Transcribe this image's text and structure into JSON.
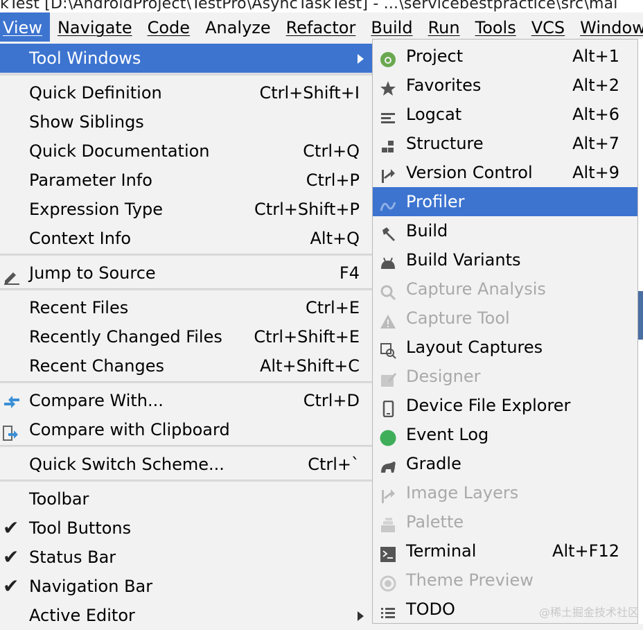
{
  "window": {
    "title": "kTest [D:\\AndroidProject\\TestPro\\AsyncTaskTest] - ...\\servicebestpractice\\src\\mai"
  },
  "menubar": {
    "items": [
      {
        "label": "View",
        "active": true
      },
      {
        "label": "Navigate"
      },
      {
        "label": "Code"
      },
      {
        "label": "Analyze"
      },
      {
        "label": "Refactor"
      },
      {
        "label": "Build"
      },
      {
        "label": "Run"
      },
      {
        "label": "Tools"
      },
      {
        "label": "VCS"
      },
      {
        "label": "Window"
      }
    ]
  },
  "view_menu": {
    "items": [
      {
        "label": "Tool Windows",
        "shortcut": "",
        "submenu": true,
        "highlighted": true
      },
      {
        "label": "Quick Definition",
        "shortcut": "Ctrl+Shift+I"
      },
      {
        "label": "Show Siblings",
        "shortcut": ""
      },
      {
        "label": "Quick Documentation",
        "shortcut": "Ctrl+Q"
      },
      {
        "label": "Parameter Info",
        "shortcut": "Ctrl+P"
      },
      {
        "label": "Expression Type",
        "shortcut": "Ctrl+Shift+P"
      },
      {
        "label": "Context Info",
        "shortcut": "Alt+Q"
      },
      {
        "label": "Jump to Source",
        "shortcut": "F4",
        "icon": "pencil-icon"
      },
      {
        "label": "Recent Files",
        "shortcut": "Ctrl+E"
      },
      {
        "label": "Recently Changed Files",
        "shortcut": "Ctrl+Shift+E"
      },
      {
        "label": "Recent Changes",
        "shortcut": "Alt+Shift+C"
      },
      {
        "label": "Compare With...",
        "shortcut": "Ctrl+D",
        "icon": "compare-arrows-icon"
      },
      {
        "label": "Compare with Clipboard",
        "shortcut": "",
        "icon": "compare-clipboard-icon"
      },
      {
        "label": "Quick Switch Scheme...",
        "shortcut": "Ctrl+`"
      },
      {
        "label": "Toolbar",
        "shortcut": ""
      },
      {
        "label": "Tool Buttons",
        "shortcut": "",
        "checked": true
      },
      {
        "label": "Status Bar",
        "shortcut": "",
        "checked": true
      },
      {
        "label": "Navigation Bar",
        "shortcut": "",
        "checked": true
      },
      {
        "label": "Active Editor",
        "shortcut": "",
        "submenu": true
      }
    ]
  },
  "tool_windows": {
    "items": [
      {
        "label": "Project",
        "shortcut": "Alt+1",
        "icon": "android-project-icon"
      },
      {
        "label": "Favorites",
        "shortcut": "Alt+2",
        "icon": "star-icon"
      },
      {
        "label": "Logcat",
        "shortcut": "Alt+6",
        "icon": "logcat-icon"
      },
      {
        "label": "Structure",
        "shortcut": "Alt+7",
        "icon": "structure-icon"
      },
      {
        "label": "Version Control",
        "shortcut": "Alt+9",
        "icon": "version-control-icon"
      },
      {
        "label": "Profiler",
        "shortcut": "",
        "icon": "profiler-icon",
        "highlighted": true
      },
      {
        "label": "Build",
        "shortcut": "",
        "icon": "hammer-icon"
      },
      {
        "label": "Build Variants",
        "shortcut": "",
        "icon": "android-icon"
      },
      {
        "label": "Capture Analysis",
        "shortcut": "",
        "icon": "magnifier-icon",
        "disabled": true
      },
      {
        "label": "Capture Tool",
        "shortcut": "",
        "icon": "warning-triangle-icon",
        "disabled": true
      },
      {
        "label": "Layout Captures",
        "shortcut": "",
        "icon": "layout-capture-icon"
      },
      {
        "label": "Designer",
        "shortcut": "",
        "icon": "designer-icon",
        "disabled": true
      },
      {
        "label": "Device File Explorer",
        "shortcut": "",
        "icon": "phone-icon"
      },
      {
        "label": "Event Log",
        "shortcut": "",
        "icon": "event-log-icon"
      },
      {
        "label": "Gradle",
        "shortcut": "",
        "icon": "gradle-elephant-icon"
      },
      {
        "label": "Image Layers",
        "shortcut": "",
        "icon": "image-layers-icon",
        "disabled": true
      },
      {
        "label": "Palette",
        "shortcut": "",
        "icon": "palette-icon",
        "disabled": true
      },
      {
        "label": "Terminal",
        "shortcut": "Alt+F12",
        "icon": "terminal-icon"
      },
      {
        "label": "Theme Preview",
        "shortcut": "",
        "icon": "theme-preview-icon",
        "disabled": true
      },
      {
        "label": "TODO",
        "shortcut": "",
        "icon": "todo-list-icon"
      }
    ]
  },
  "watermark": "@稀土掘金技术社区",
  "colors": {
    "highlight": "#3d74d0",
    "menu_bg": "#f2f2f2",
    "disabled_text": "#a9a9a9"
  }
}
